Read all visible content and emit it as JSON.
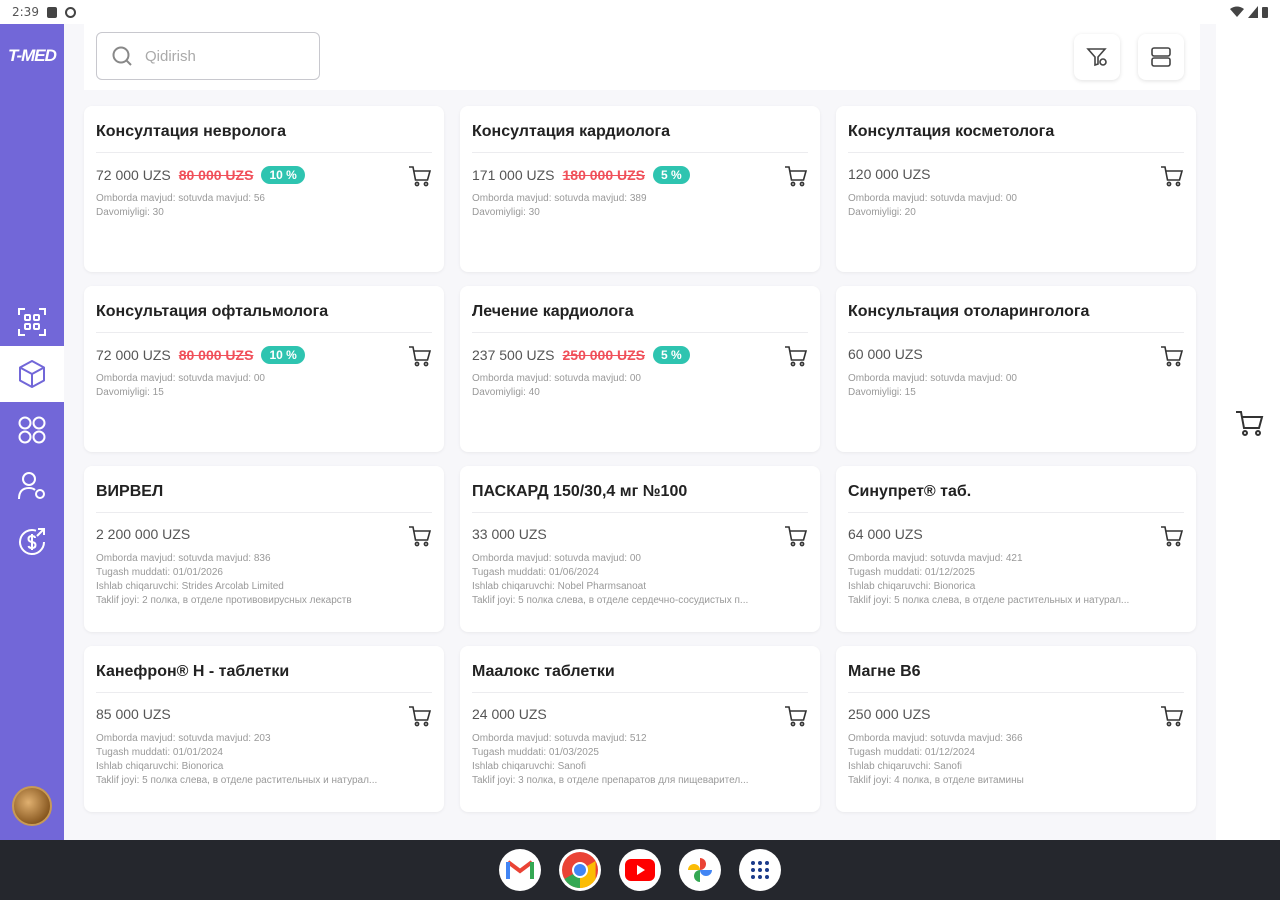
{
  "status_bar": {
    "time": "2:39"
  },
  "logo": "T-MED",
  "search": {
    "placeholder": "Qidirish"
  },
  "products": [
    {
      "title": "Консултация невролога",
      "price": "72 000 UZS",
      "old_price": "80 000 UZS",
      "discount": "10 %",
      "lines": [
        "Omborda mavjud: sotuvda mavjud: 56",
        "Davomiyligi: 30"
      ]
    },
    {
      "title": "Консултация кардиолога",
      "price": "171 000 UZS",
      "old_price": "180 000 UZS",
      "discount": "5 %",
      "lines": [
        "Omborda mavjud: sotuvda mavjud: 389",
        "Davomiyligi: 30"
      ]
    },
    {
      "title": "Консултация косметолога",
      "price": "120 000 UZS",
      "old_price": "",
      "discount": "",
      "lines": [
        "Omborda mavjud: sotuvda mavjud: 00",
        "Davomiyligi: 20"
      ]
    },
    {
      "title": "Консультация офтальмолога",
      "price": "72 000 UZS",
      "old_price": "80 000 UZS",
      "discount": "10 %",
      "lines": [
        "Omborda mavjud: sotuvda mavjud: 00",
        "Davomiyligi: 15"
      ]
    },
    {
      "title": "Лечение кардиолога",
      "price": "237 500 UZS",
      "old_price": "250 000 UZS",
      "discount": "5 %",
      "lines": [
        "Omborda mavjud: sotuvda mavjud: 00",
        "Davomiyligi: 40"
      ]
    },
    {
      "title": "Консультация отоларинголога",
      "price": "60 000 UZS",
      "old_price": "",
      "discount": "",
      "lines": [
        "Omborda mavjud: sotuvda mavjud: 00",
        "Davomiyligi: 15"
      ]
    },
    {
      "title": "ВИРВЕЛ",
      "price": "2 200 000 UZS",
      "old_price": "",
      "discount": "",
      "lines": [
        "Omborda mavjud: sotuvda mavjud: 836",
        "Tugash muddati: 01/01/2026",
        "Ishlab chiqaruvchi: Strides Arcolab Limited",
        "Taklif joyi: 2 полка, в отделе противовирусных лекарств"
      ]
    },
    {
      "title": "ПАСКАРД 150/30,4 мг №100",
      "price": "33 000 UZS",
      "old_price": "",
      "discount": "",
      "lines": [
        "Omborda mavjud: sotuvda mavjud: 00",
        "Tugash muddati: 01/06/2024",
        "Ishlab chiqaruvchi: Nobel Pharmsanoat",
        "Taklif joyi: 5 полка слева, в отделе сердечно-сосудистых п..."
      ]
    },
    {
      "title": "Синупрет® таб.",
      "price": "64 000 UZS",
      "old_price": "",
      "discount": "",
      "lines": [
        "Omborda mavjud: sotuvda mavjud: 421",
        "Tugash muddati: 01/12/2025",
        "Ishlab chiqaruvchi: Bionorica",
        "Taklif joyi: 5 полка слева, в отделе растительных и натурал..."
      ]
    },
    {
      "title": "Канефрон® Н - таблетки",
      "price": "85 000 UZS",
      "old_price": "",
      "discount": "",
      "lines": [
        "Omborda mavjud: sotuvda mavjud: 203",
        "Tugash muddati: 01/01/2024",
        "Ishlab chiqaruvchi: Bionorica",
        "Taklif joyi: 5 полка слева, в отделе растительных и натурал..."
      ]
    },
    {
      "title": "Маалокс таблетки",
      "price": "24 000 UZS",
      "old_price": "",
      "discount": "",
      "lines": [
        "Omborda mavjud: sotuvda mavjud: 512",
        "Tugash muddati: 01/03/2025",
        "Ishlab chiqaruvchi: Sanofi",
        "Taklif joyi: 3 полка, в отделе препаратов для пищеварител..."
      ]
    },
    {
      "title": "Магне B6",
      "price": "250 000 UZS",
      "old_price": "",
      "discount": "",
      "lines": [
        "Omborda mavjud: sotuvda mavjud: 366",
        "Tugash muddati: 01/12/2024",
        "Ishlab chiqaruvchi: Sanofi",
        "Taklif joyi: 4 полка, в отделе витамины"
      ]
    }
  ],
  "colors": {
    "accent": "#7267d8",
    "discount_badge": "#2ec4b0",
    "old_price": "#f0505a"
  },
  "icons": {
    "sidebar": [
      "scan-icon",
      "box-icon",
      "apps-icon",
      "user-settings-icon",
      "money-exchange-icon"
    ],
    "taskbar": [
      "gmail-icon",
      "chrome-icon",
      "youtube-icon",
      "photos-icon",
      "app-drawer-icon"
    ]
  }
}
